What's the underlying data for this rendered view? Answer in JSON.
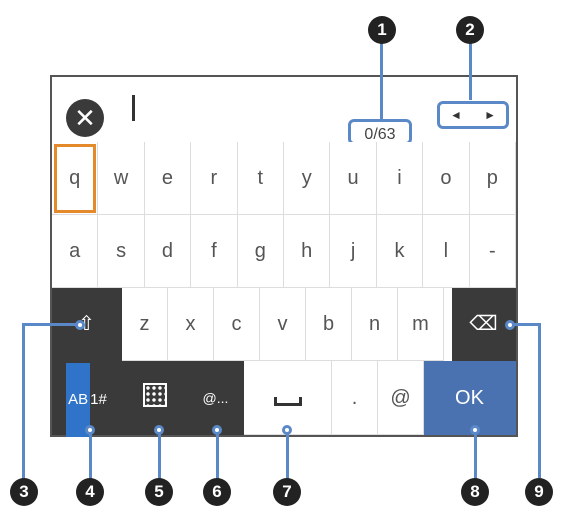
{
  "input": {
    "counter": "0/63",
    "left_arrow": "◄",
    "right_arrow": "►",
    "clear_symbol": "✕"
  },
  "keyboard": {
    "row1": [
      "q",
      "w",
      "e",
      "r",
      "t",
      "y",
      "u",
      "i",
      "o",
      "p"
    ],
    "row2": [
      "a",
      "s",
      "d",
      "f",
      "g",
      "h",
      "j",
      "k",
      "l",
      "-"
    ],
    "row3": [
      "z",
      "x",
      "c",
      "v",
      "b",
      "n",
      "m"
    ],
    "shift_symbol": "⇧",
    "backspace_symbol": "⌫",
    "mode_ab": "AB",
    "mode_num": "1#",
    "symbols_label": "@...",
    "period": ".",
    "at": "@",
    "ok": "OK"
  },
  "callouts": [
    "1",
    "2",
    "3",
    "4",
    "5",
    "6",
    "7",
    "8",
    "9"
  ]
}
